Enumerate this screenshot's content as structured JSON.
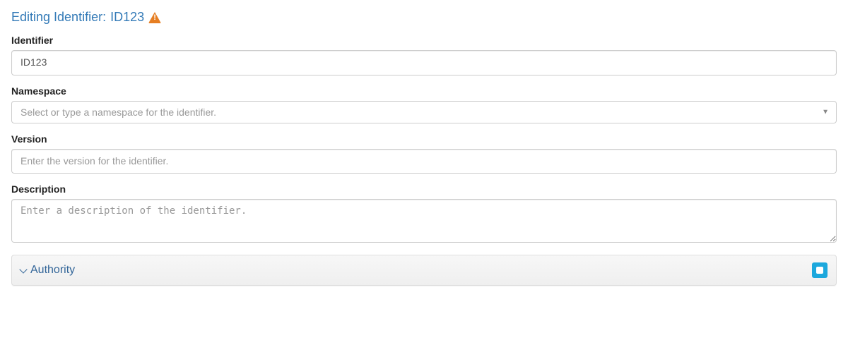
{
  "header": {
    "title_prefix": "Editing Identifier:",
    "identifier_value": "ID123"
  },
  "fields": {
    "identifier": {
      "label": "Identifier",
      "value": "ID123"
    },
    "namespace": {
      "label": "Namespace",
      "placeholder": "Select or type a namespace for the identifier."
    },
    "version": {
      "label": "Version",
      "placeholder": "Enter the version for the identifier."
    },
    "description": {
      "label": "Description",
      "placeholder": "Enter a description of the identifier."
    }
  },
  "panel": {
    "authority_label": "Authority"
  }
}
